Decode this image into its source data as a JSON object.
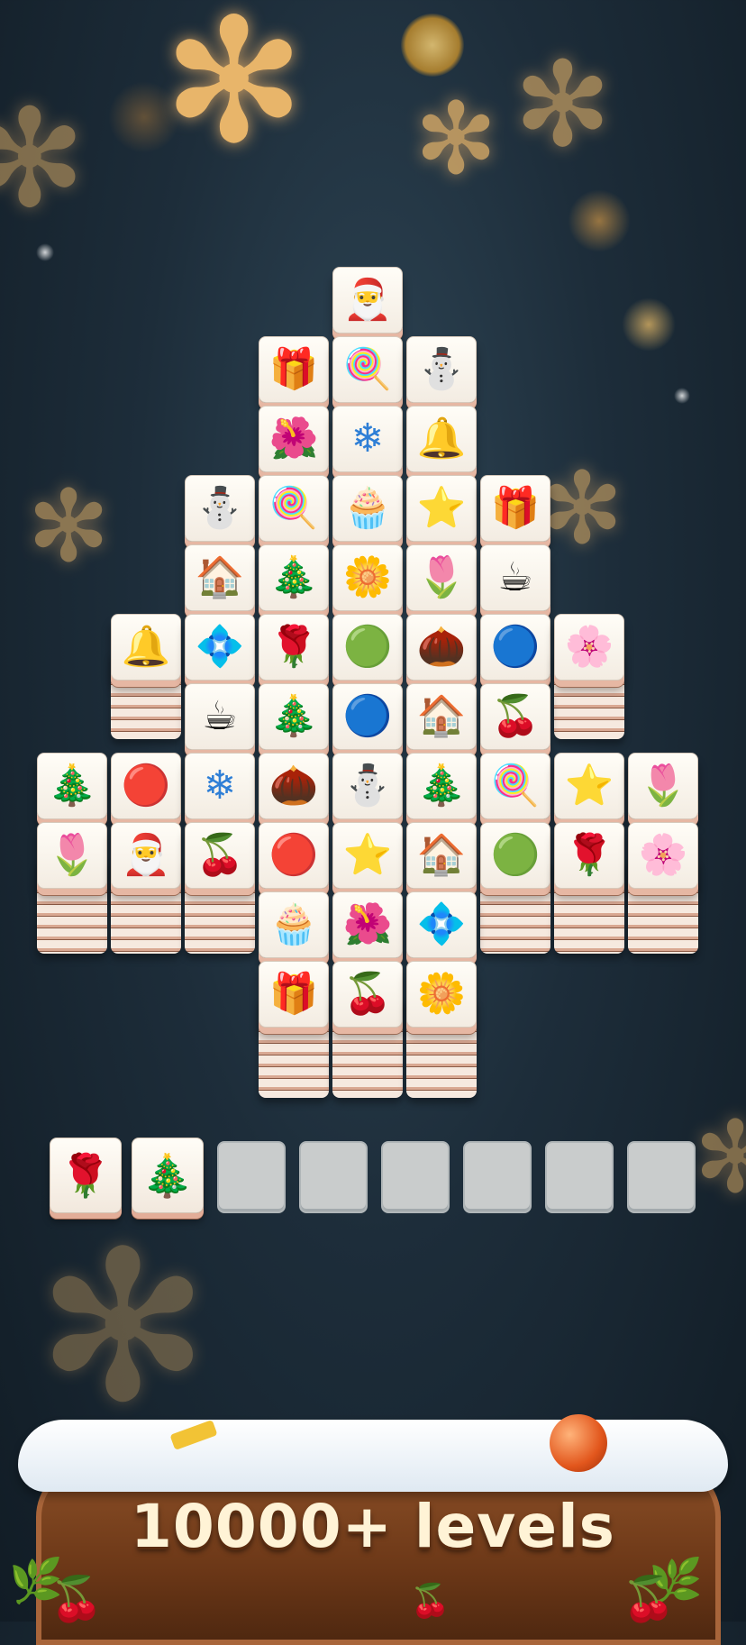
{
  "banner": {
    "text": "10000+ levels"
  },
  "board": {
    "rows": [
      {
        "tiles": [
          "santa"
        ]
      },
      {
        "tiles": [
          "gift",
          "candy-cane",
          "snowman"
        ]
      },
      {
        "tiles": [
          "poinsettia-pink",
          "snowflake",
          "bell"
        ]
      },
      {
        "tiles": [
          "snowman",
          "candy-cane",
          "cupcake",
          "gold-star",
          "gift"
        ]
      },
      {
        "tiles": [
          "snow-globe",
          "wreath",
          "white-flower",
          "iris",
          "cocoa-mug"
        ]
      },
      {
        "tiles": [
          "bell",
          "poinsettia-blue",
          "red-camellia",
          "green-ornament",
          "pinecone",
          "blue-pansy",
          "hellebore"
        ]
      },
      {
        "tiles": [
          "cocoa-mug",
          "xmas-tree",
          "blue-pansy",
          "snow-globe",
          "holly"
        ]
      },
      {
        "tiles": [
          "xmas-tree",
          "striped-ornament",
          "snowflake",
          "pinecone",
          "snowman",
          "wreath",
          "candy-cane",
          "gold-star",
          "iris"
        ]
      },
      {
        "tiles": [
          "iris",
          "santa",
          "holly",
          "striped-ornament",
          "gold-star",
          "snow-globe",
          "green-ornament",
          "red-camellia",
          "hellebore"
        ]
      },
      {
        "tiles": [
          "cupcake",
          "poinsettia-pink",
          "poinsettia-blue"
        ]
      },
      {
        "tiles": [
          "gift",
          "holly",
          "white-flower"
        ]
      }
    ]
  },
  "tray": {
    "filled": [
      "red-camellia",
      "wreath"
    ],
    "slots_total": 8
  }
}
